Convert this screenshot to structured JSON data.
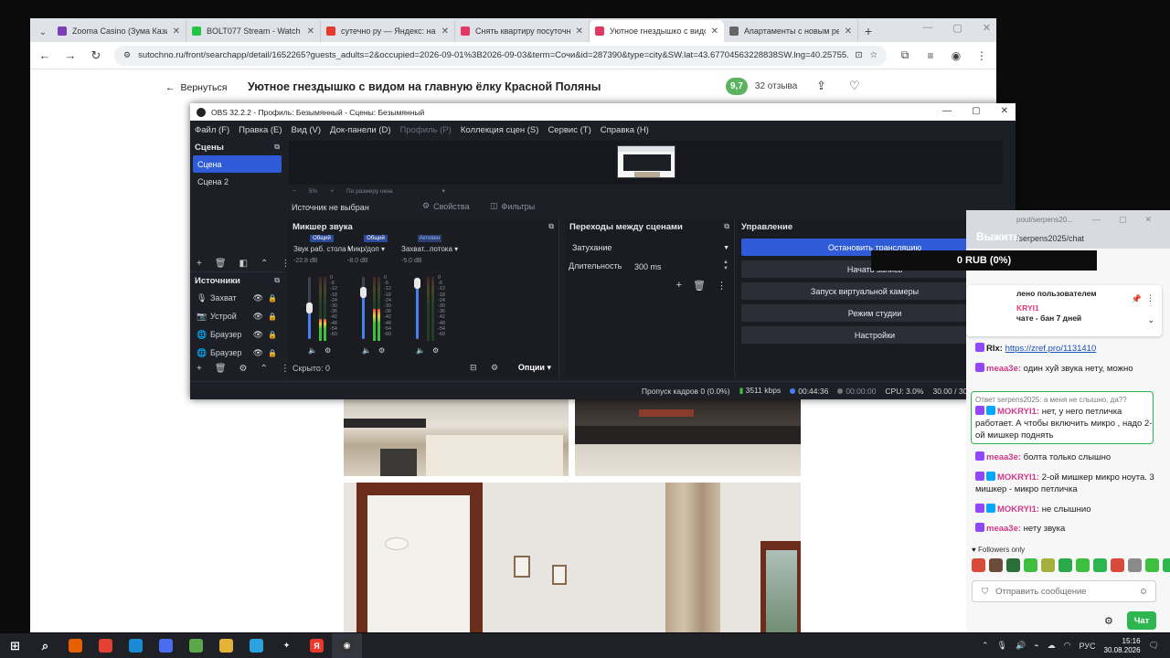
{
  "browser": {
    "tabs": [
      {
        "title": "Zooma Casino (Зума Казин",
        "color": "#7b3fb5",
        "active": false
      },
      {
        "title": "BOLT077 Stream - Watch Li",
        "color": "#24c447",
        "active": false
      },
      {
        "title": "сутечно ру — Яндекс: нашл",
        "color": "#e8392c",
        "active": false
      },
      {
        "title": "Снять квартиру посуточно",
        "color": "#e03a62",
        "active": false
      },
      {
        "title": "Уютное гнездышко с видом",
        "color": "#e03a62",
        "active": true
      },
      {
        "title": "Апартаменты с новым ремо",
        "color": "#666666",
        "active": false
      }
    ],
    "url": "sutochno.ru/front/searchapp/detail/1652265?guests_adults=2&occupied=2026-09-01%3B2026-09-03&term=Сочи&id=287390&type=city&SW.lat=43.67704563228838SW.lng=40.25755...",
    "back_label": "Вернуться",
    "page_title": "Уютное гнездышко с видом на главную ёлку Красной Поляны",
    "score": "9,7",
    "reviews": "32 отзыва"
  },
  "obs": {
    "title": "OBS 32.2.2 - Профиль: Безымянный - Сцены: Безымянный",
    "menu": [
      {
        "label": "Файл (F)",
        "disabled": false
      },
      {
        "label": "Правка (E)",
        "disabled": false
      },
      {
        "label": "Вид (V)",
        "disabled": false
      },
      {
        "label": "Док-панели (D)",
        "disabled": false
      },
      {
        "label": "Профиль (P)",
        "disabled": true
      },
      {
        "label": "Коллекция сцен (S)",
        "disabled": false
      },
      {
        "label": "Сервис (T)",
        "disabled": false
      },
      {
        "label": "Справка (H)",
        "disabled": false
      }
    ],
    "scenes_title": "Сцены",
    "scenes": [
      "Сцена",
      "Сцена 2"
    ],
    "sources_title": "Источники",
    "sources": [
      {
        "name": "Захват",
        "icon": "mic-icon"
      },
      {
        "name": "Устрой",
        "icon": "camera-icon"
      },
      {
        "name": "Браузер",
        "icon": "globe-icon"
      },
      {
        "name": "Браузер",
        "icon": "globe-icon"
      }
    ],
    "zoom_minus": "−",
    "zoom_value": "5%",
    "zoom_plus": "+",
    "zoom_mode": "По размеру окна",
    "no_source": "Источник не выбран",
    "properties": "Свойства",
    "filters": "Фильтры",
    "mixer": {
      "title": "Микшер звука",
      "channels": [
        {
          "badge": "Общий",
          "name": "Звук раб. стола",
          "db": "-22.8 dB",
          "level": 0.45,
          "meter": 0.35
        },
        {
          "badge": "Общий",
          "name": "Микр/доп",
          "db": "-8.0 dB",
          "level": 0.72,
          "meter": 0.5
        },
        {
          "badge": "Активен",
          "name": "Захват...потока",
          "db": "-5.0 dB",
          "level": 0.88,
          "meter": 0.0
        }
      ],
      "scale": [
        "0",
        "-6",
        "-12",
        "-18",
        "-24",
        "-30",
        "-36",
        "-42",
        "-48",
        "-54",
        "-60"
      ],
      "hidden": "Скрыто: 0",
      "options": "Опции"
    },
    "transitions": {
      "title": "Переходы между сценами",
      "type": "Затухание",
      "duration_label": "Длительность",
      "duration": "300 ms"
    },
    "controls": {
      "title": "Управление",
      "buttons": [
        "Остановить трансляцию",
        "Начать запись",
        "Запуск виртуальной камеры",
        "Режим студии",
        "Настройки"
      ]
    },
    "status": {
      "dropped": "Пропуск кадров 0 (0.0%)",
      "bitrate": "3511 kbps",
      "stream_time": "00:44:36",
      "rec_time": "00:00:00",
      "cpu": "CPU: 3.0%",
      "fps": "30.00 / 30.00 FPS"
    }
  },
  "chat": {
    "url1": "pout/serpens20...",
    "url2": "/serpens2025/chat",
    "overlay_label": "Выжить",
    "overlay_rub": "0 RUB (0%)",
    "notice_line1": "лено пользователем",
    "notice_user": "KRYI1",
    "notice_line2": "чате - бан 7 дней",
    "messages": [
      {
        "user": "RIx:",
        "text": "https://zref.pro/1131410",
        "color": "#1b1b1b",
        "link": true
      },
      {
        "user": "meaa3e:",
        "text": "один хуй звука нету, можно",
        "color": "#d13a8a"
      },
      {
        "user": "",
        "text": "Ответ serpens2025: а меня не слышно, да??",
        "color": "#777777"
      },
      {
        "user": "MOKRYI1:",
        "text": "нет, у него петличка работает. А чтобы включить микро , надо 2-ой мишкер поднять",
        "color": "#d13a8a"
      },
      {
        "user": "meaa3e:",
        "text": "болта только слышно",
        "color": "#d13a8a"
      },
      {
        "user": "MOKRYI1:",
        "text": "2-ой мишкер микро ноута. 3 мишкер - микро петличка",
        "color": "#d13a8a"
      },
      {
        "user": "MOKRYI1:",
        "text": "не слышнио",
        "color": "#d13a8a"
      },
      {
        "user": "meaa3e:",
        "text": "нету звука",
        "color": "#d13a8a"
      }
    ],
    "followers": "Followers only",
    "input_placeholder": "Отправить сообщение",
    "chat_button": "Чат"
  },
  "taskbar": {
    "lang": "РУС",
    "time": "15:16",
    "date": "30.08.2026"
  }
}
